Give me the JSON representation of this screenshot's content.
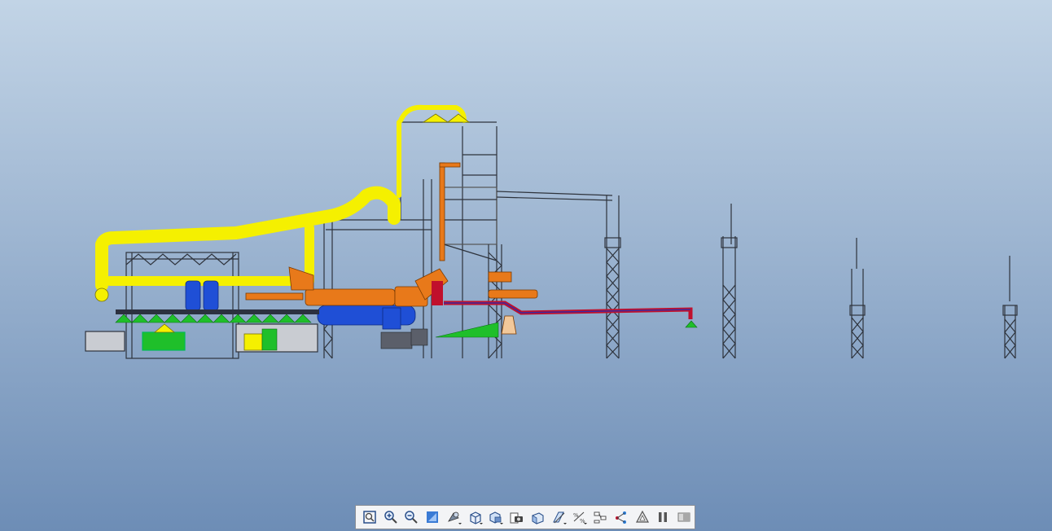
{
  "viewport": {
    "background_top": "#c2d4e6",
    "background_bottom": "#6d8db6",
    "model": {
      "name": "plant-assembly",
      "colors": {
        "duct": "#f5f000",
        "structure": "#3a3f4a",
        "rotary_drum": "#e8791a",
        "tank": "#1f4fd6",
        "hot_pipe": "#c0102c",
        "conveyor": "#1fbf2a",
        "panel": "#c9ccd2"
      }
    }
  },
  "toolbar": {
    "buttons": [
      {
        "id": "refit",
        "icon": "zoom-fit-icon"
      },
      {
        "id": "zoom-in",
        "icon": "zoom-in-icon"
      },
      {
        "id": "zoom-out",
        "icon": "zoom-out-icon"
      },
      {
        "id": "repaint",
        "icon": "repaint-icon"
      },
      {
        "id": "display-style",
        "icon": "shaded-style-icon",
        "menu": true
      },
      {
        "id": "standard-orientation",
        "icon": "cube-view-icon",
        "menu": true
      },
      {
        "id": "saved-views",
        "icon": "saved-views-icon",
        "menu": true
      },
      {
        "id": "view-manager",
        "icon": "camera-views-icon"
      },
      {
        "id": "perspective",
        "icon": "perspective-icon"
      },
      {
        "id": "datum-display",
        "icon": "datum-display-icon",
        "menu": true
      },
      {
        "id": "annotation-display",
        "icon": "annotation-display-icon",
        "menu": true
      },
      {
        "id": "spin-center",
        "icon": "spin-center-icon"
      },
      {
        "id": "tree-display",
        "icon": "model-tree-icon"
      },
      {
        "id": "appearance",
        "icon": "appearance-icon"
      },
      {
        "id": "pause",
        "icon": "pause-icon"
      },
      {
        "id": "section",
        "icon": "section-icon"
      }
    ]
  }
}
